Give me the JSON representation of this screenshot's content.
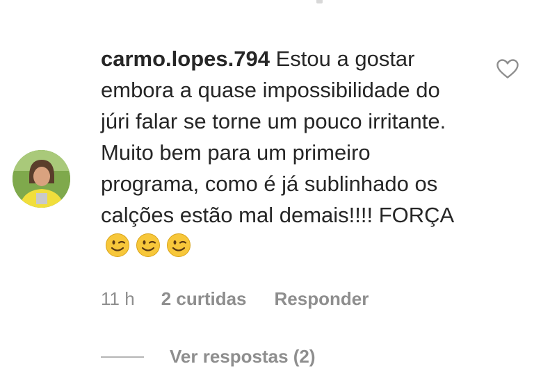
{
  "comment": {
    "username": "carmo.lopes.794",
    "text": "Estou a gostar embora a quase impossibilidade do júri falar se torne um pouco irritante. Muito bem para um primeiro programa, como é já sublinhado os calções estão mal demais!!!! FORÇA",
    "emojis": [
      "winking-face-emoji",
      "winking-face-emoji",
      "winking-face-emoji"
    ],
    "time": "11 h",
    "likes": "2 curtidas",
    "reply_label": "Responder",
    "view_replies_label": "Ver respostas (2)"
  },
  "icons": {
    "like": "heart-outline-icon",
    "avatar": "user-avatar"
  },
  "colors": {
    "text": "#262626",
    "secondary_text": "#8e8e8e",
    "divider": "#b5b5b5",
    "emoji_face": "#f7c73a"
  }
}
